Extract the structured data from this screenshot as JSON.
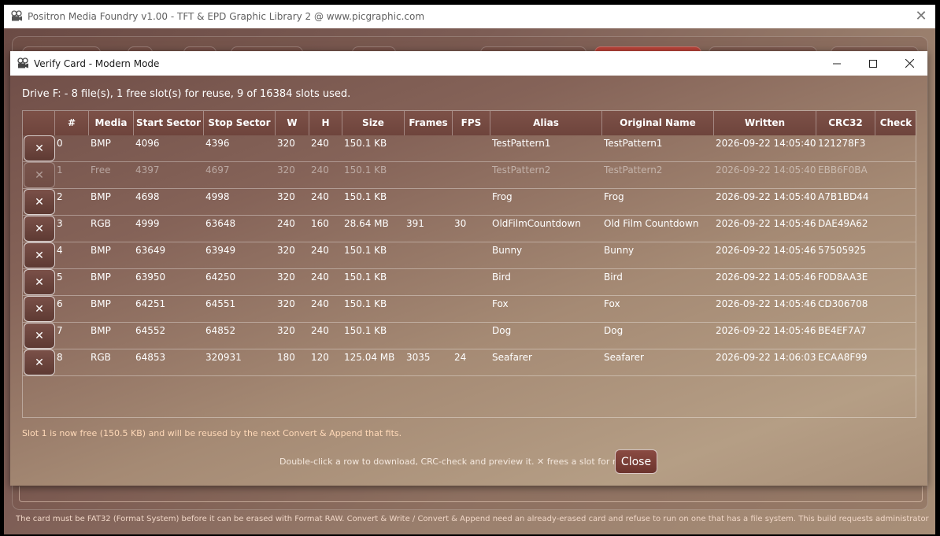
{
  "main_window": {
    "title": "Positron Media Foundry v1.00 - TFT & EPD Graphic Library 2 @ www.picgraphic.com",
    "close_glyph": "✕",
    "footer": "The card must be FAT32 (Format System) before it can be erased with Format RAW. Convert & Write / Convert & Append need an already-erased card and refuse to run on one that has a file system. This build requests administrator rights."
  },
  "dialog": {
    "title": "Verify Card - Modern Mode",
    "summary": "Drive F: - 8 file(s), 1 free slot(s) for reuse, 9 of 16384 slots used.",
    "freed_message": "Slot 1 is now free (150.5 KB) and will be reused by the next Convert & Append that fits.",
    "hint": "Double-click a row to download, CRC-check and preview it.  ✕ frees a slot for reuse.",
    "close_label": "Close",
    "delete_glyph": "✕"
  },
  "table": {
    "columns": [
      "",
      "#",
      "Media",
      "Start Sector",
      "Stop Sector",
      "W",
      "H",
      "Size",
      "Frames",
      "FPS",
      "Alias",
      "Original Name",
      "Written",
      "CRC32",
      "Check"
    ],
    "rows": [
      {
        "num": "0",
        "media": "BMP",
        "start": "4096",
        "stop": "4396",
        "w": "320",
        "h": "240",
        "size": "150.1 KB",
        "frames": "",
        "fps": "",
        "alias": "TestPattern1",
        "original": "TestPattern1",
        "written": "2026-09-22 14:05:40",
        "crc": "121278F3",
        "check": "",
        "free": false
      },
      {
        "num": "1",
        "media": "Free",
        "start": "4397",
        "stop": "4697",
        "w": "320",
        "h": "240",
        "size": "150.1 KB",
        "frames": "",
        "fps": "",
        "alias": "TestPattern2",
        "original": "TestPattern2",
        "written": "2026-09-22 14:05:40",
        "crc": "EBB6F0BA",
        "check": "",
        "free": true
      },
      {
        "num": "2",
        "media": "BMP",
        "start": "4698",
        "stop": "4998",
        "w": "320",
        "h": "240",
        "size": "150.1 KB",
        "frames": "",
        "fps": "",
        "alias": "Frog",
        "original": "Frog",
        "written": "2026-09-22 14:05:40",
        "crc": "A7B1BD44",
        "check": "",
        "free": false
      },
      {
        "num": "3",
        "media": "RGB",
        "start": "4999",
        "stop": "63648",
        "w": "240",
        "h": "160",
        "size": "28.64 MB",
        "frames": "391",
        "fps": "30",
        "alias": "OldFilmCountdown",
        "original": "Old Film Countdown",
        "written": "2026-09-22 14:05:46",
        "crc": "DAE49A62",
        "check": "",
        "free": false
      },
      {
        "num": "4",
        "media": "BMP",
        "start": "63649",
        "stop": "63949",
        "w": "320",
        "h": "240",
        "size": "150.1 KB",
        "frames": "",
        "fps": "",
        "alias": "Bunny",
        "original": "Bunny",
        "written": "2026-09-22 14:05:46",
        "crc": "57505925",
        "check": "",
        "free": false
      },
      {
        "num": "5",
        "media": "BMP",
        "start": "63950",
        "stop": "64250",
        "w": "320",
        "h": "240",
        "size": "150.1 KB",
        "frames": "",
        "fps": "",
        "alias": "Bird",
        "original": "Bird",
        "written": "2026-09-22 14:05:46",
        "crc": "F0D8AA3E",
        "check": "",
        "free": false
      },
      {
        "num": "6",
        "media": "BMP",
        "start": "64251",
        "stop": "64551",
        "w": "320",
        "h": "240",
        "size": "150.1 KB",
        "frames": "",
        "fps": "",
        "alias": "Fox",
        "original": "Fox",
        "written": "2026-09-22 14:05:46",
        "crc": "CD306708",
        "check": "",
        "free": false
      },
      {
        "num": "7",
        "media": "BMP",
        "start": "64552",
        "stop": "64852",
        "w": "320",
        "h": "240",
        "size": "150.1 KB",
        "frames": "",
        "fps": "",
        "alias": "Dog",
        "original": "Dog",
        "written": "2026-09-22 14:05:46",
        "crc": "BE4EF7A7",
        "check": "",
        "free": false
      },
      {
        "num": "8",
        "media": "RGB",
        "start": "64853",
        "stop": "320931",
        "w": "180",
        "h": "120",
        "size": "125.04 MB",
        "frames": "3035",
        "fps": "24",
        "alias": "Seafarer",
        "original": "Seafarer",
        "written": "2026-09-22 14:06:03",
        "crc": "ECAA8F99",
        "check": "",
        "free": false
      }
    ]
  }
}
